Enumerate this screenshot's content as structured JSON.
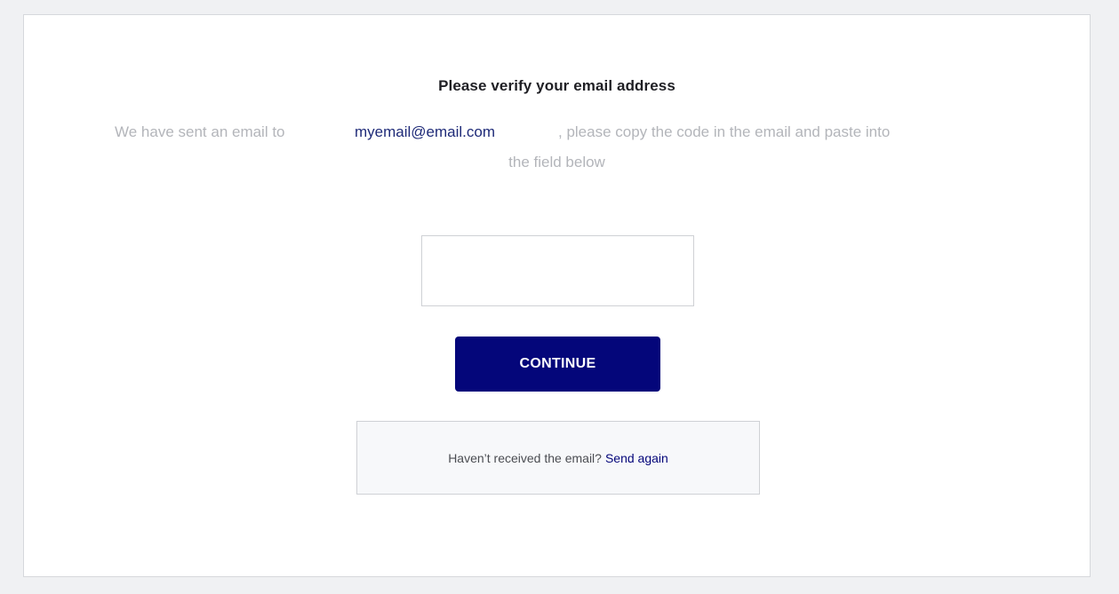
{
  "verify": {
    "title": "Please verify your email address",
    "desc_prefix": "We have sent an email to",
    "email": "myemail@email.com",
    "desc_suffix": ", please copy the code in the email and paste into",
    "desc_line2": "the field below"
  },
  "code_field": {
    "value": "",
    "placeholder": ""
  },
  "continue_label": "CONTINUE",
  "resend": {
    "text": "Haven’t received the email?",
    "link": "Send again"
  },
  "colors": {
    "background": "#f0f1f3",
    "card": "#ffffff",
    "primary": "#04067a",
    "muted_text": "#b3b5ba",
    "email_text": "#1e2a78"
  }
}
